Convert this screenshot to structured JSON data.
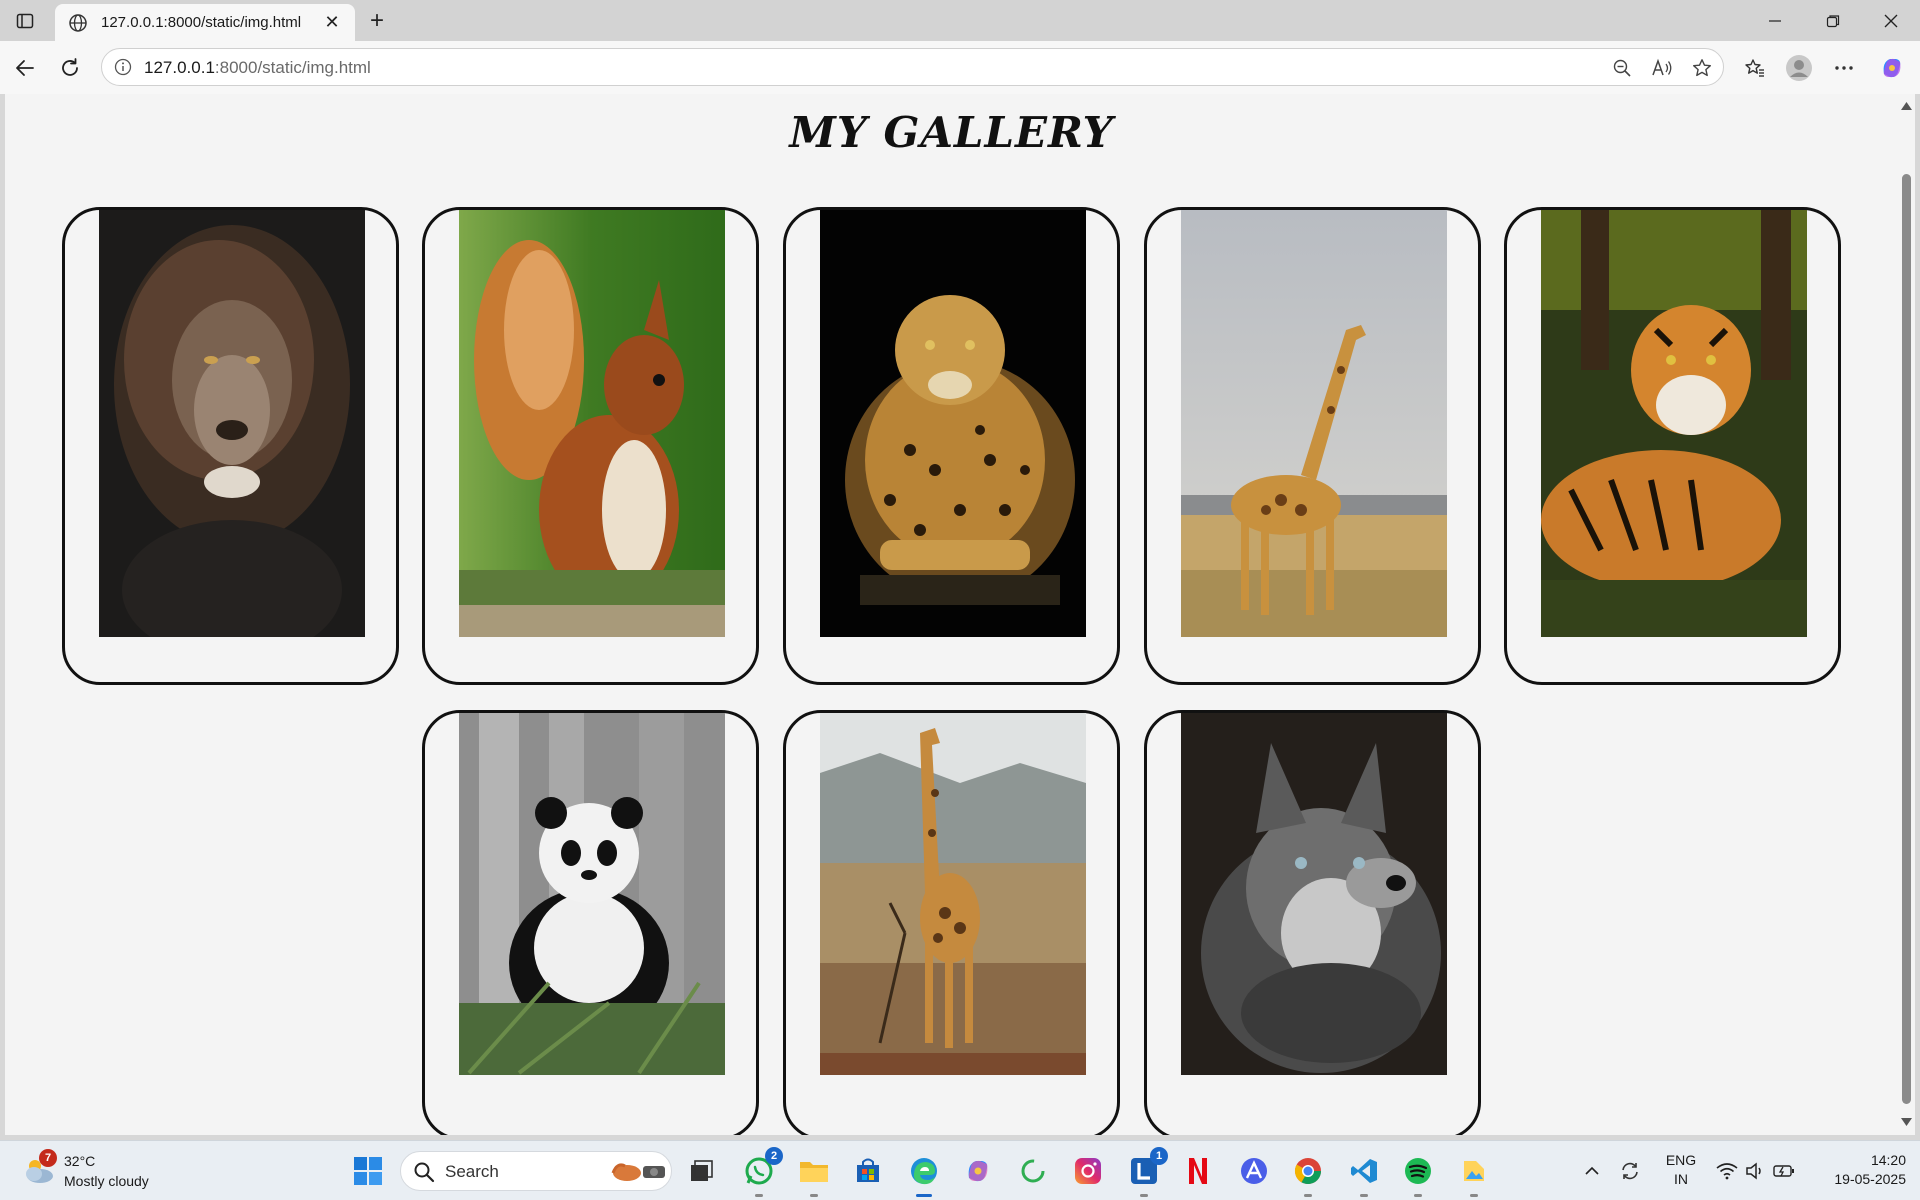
{
  "browser": {
    "tab_title": "127.0.0.1:8000/static/img.html",
    "url_host": "127.0.0.1",
    "url_path": ":8000/static/img.html"
  },
  "page": {
    "title": "MY GALLERY",
    "images": [
      {
        "alt": "lion",
        "icon": "lion-photo"
      },
      {
        "alt": "squirrel",
        "icon": "squirrel-photo"
      },
      {
        "alt": "leopard",
        "icon": "leopard-photo"
      },
      {
        "alt": "giraffe",
        "icon": "giraffe-photo"
      },
      {
        "alt": "tiger",
        "icon": "tiger-photo"
      },
      {
        "alt": "panda",
        "icon": "panda-photo"
      },
      {
        "alt": "giraffe",
        "icon": "giraffe-photo"
      },
      {
        "alt": "wolf",
        "icon": "wolf-photo"
      }
    ]
  },
  "taskbar": {
    "weather_temp": "32°C",
    "weather_cond": "Mostly cloudy",
    "weather_badge": "7",
    "search_label": "Search",
    "whatsapp_badge": "2",
    "l_app_badge": "1",
    "lang_1": "ENG",
    "lang_2": "IN",
    "time": "14:20",
    "date": "19-05-2025"
  },
  "colors": {
    "page_bg": "#f4f4f4",
    "card_border": "#111111",
    "accent": "#1a66c8"
  }
}
